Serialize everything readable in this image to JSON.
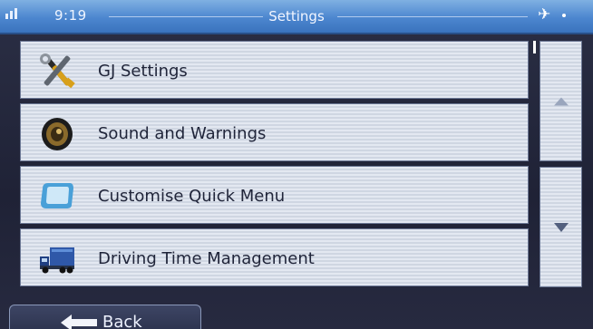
{
  "status_bar": {
    "time": "9:19",
    "title": "Settings"
  },
  "menu": {
    "items": [
      {
        "label": "GJ Settings",
        "icon": "tools-icon"
      },
      {
        "label": "Sound and Warnings",
        "icon": "speaker-icon"
      },
      {
        "label": "Customise Quick Menu",
        "icon": "quick-menu-icon"
      },
      {
        "label": "Driving Time Management",
        "icon": "truck-icon"
      }
    ]
  },
  "scroll": {
    "up_icon": "arrow-up-icon",
    "down_icon": "arrow-down-icon"
  },
  "footer": {
    "back_label": "Back"
  },
  "colors": {
    "status_bar": "#4c86cf",
    "background": "#1f2236",
    "row": "#dfe4ee",
    "text": "#20253a"
  }
}
